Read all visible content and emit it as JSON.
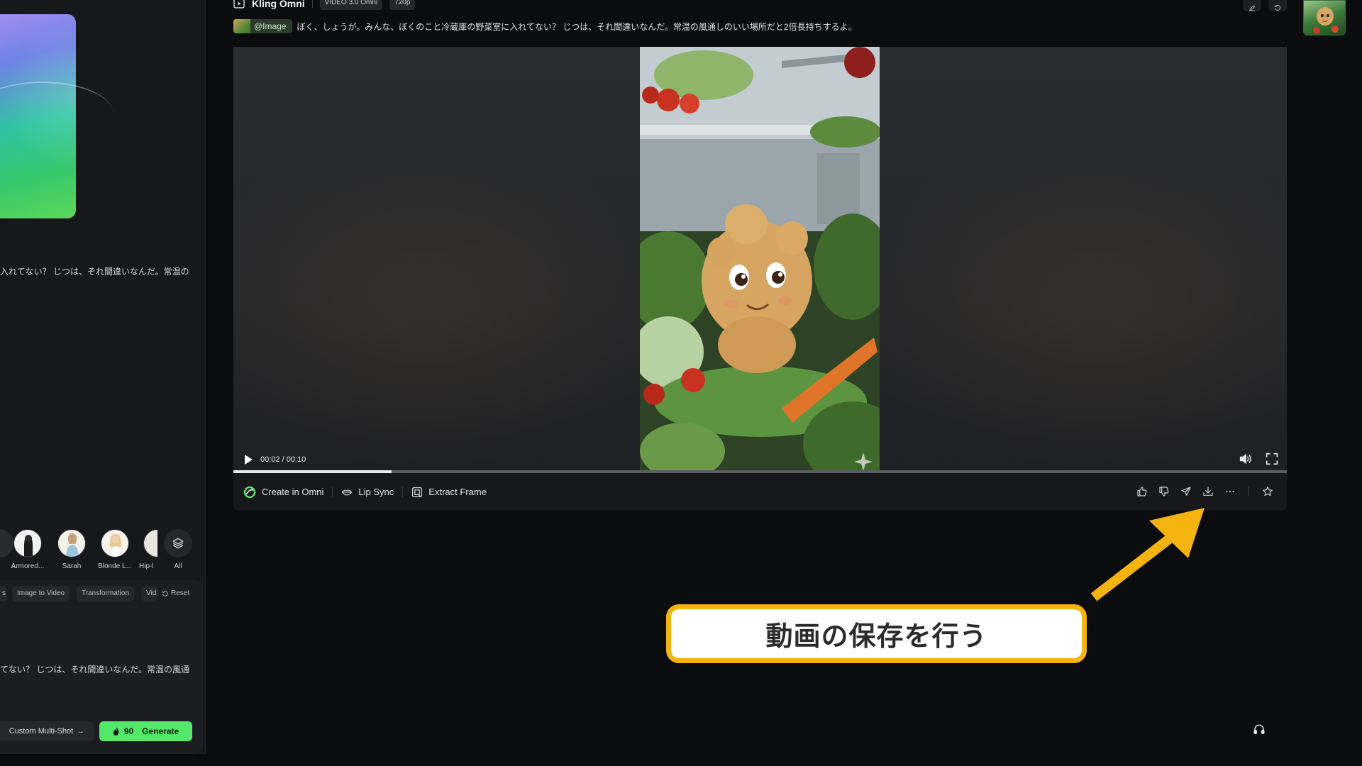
{
  "header": {
    "app_title": "Kling Omni",
    "model_badge": "VIDEO 3.0 Omni",
    "resolution_badge": "720p"
  },
  "prompt": {
    "image_tag": "@Image",
    "text": "ぼく、しょうが。みんな、ぼくのこと冷蔵庫の野菜室に入れてない？ じつは、それ間違いなんだ。常温の風通しのいい場所だと2倍長持ちするよ。"
  },
  "left_panel": {
    "prompt_snippet_1": "入れてない？ じつは、それ間違いなんだ。常温の",
    "prompt_snippet_2": "てない？ じつは、それ間違いなんだ。常温の風通",
    "avatars": [
      {
        "label": "...",
        "icon": "person-avatar"
      },
      {
        "label": "Armored...",
        "icon": "armored-avatar"
      },
      {
        "label": "Sarah",
        "icon": "person-avatar"
      },
      {
        "label": "Blonde L...",
        "icon": "person-avatar"
      },
      {
        "label": "Hip-l",
        "icon": "person-avatar"
      },
      {
        "label": "All",
        "icon": "layers-icon"
      }
    ],
    "chips": [
      "s",
      "Image to Video",
      "Transformation",
      "Vid"
    ],
    "reset_label": "Reset",
    "multi_shot_label": "Custom Multi-Shot",
    "generate": {
      "credits": "90",
      "label": "Generate"
    }
  },
  "player": {
    "time": "00:02 / 00:10",
    "progress": 0.15
  },
  "actions": {
    "create_in_omni": "Create in Omni",
    "lip_sync": "Lip Sync",
    "extract_frame": "Extract Frame"
  },
  "annotation": {
    "callout_text": "動画の保存を行う",
    "color": "#f5b30f"
  },
  "colors": {
    "accent_green": "#54e86a",
    "background": "#0b0c0e",
    "panel": "#17181b"
  }
}
